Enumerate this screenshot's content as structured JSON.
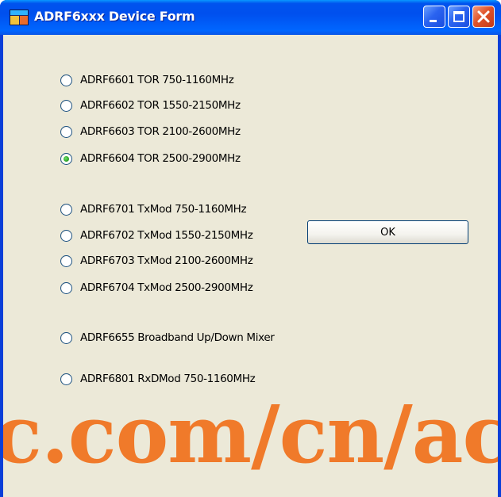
{
  "window": {
    "title": "ADRF6xxx Device Form",
    "icons": {
      "app": "app-form-icon",
      "minimize": "minimize-icon",
      "maximize": "maximize-icon",
      "close": "close-icon"
    }
  },
  "radios": [
    {
      "label": "ADRF6601 TOR 750-1160MHz",
      "checked": false
    },
    {
      "label": "ADRF6602 TOR 1550-2150MHz",
      "checked": false
    },
    {
      "label": "ADRF6603 TOR 2100-2600MHz",
      "checked": false
    },
    {
      "label": "ADRF6604 TOR 2500-2900MHz",
      "checked": true
    },
    {
      "label": "ADRF6701 TxMod 750-1160MHz",
      "checked": false
    },
    {
      "label": "ADRF6702 TxMod 1550-2150MHz",
      "checked": false
    },
    {
      "label": "ADRF6703 TxMod 2100-2600MHz",
      "checked": false
    },
    {
      "label": "ADRF6704 TxMod 2500-2900MHz",
      "checked": false
    },
    {
      "label": "ADRF6655 Broadband Up/Down Mixer",
      "checked": false
    },
    {
      "label": "ADRF6801 RxDMod 750-1160MHz",
      "checked": false
    }
  ],
  "ok_button": {
    "label": "OK"
  },
  "watermark": {
    "text": "c.com/cn/ac"
  },
  "colors": {
    "titlebar": "#0053ee",
    "client_background": "#ece9d8",
    "watermark": "#f07a2a",
    "radio_selected": "#2ea52a"
  }
}
